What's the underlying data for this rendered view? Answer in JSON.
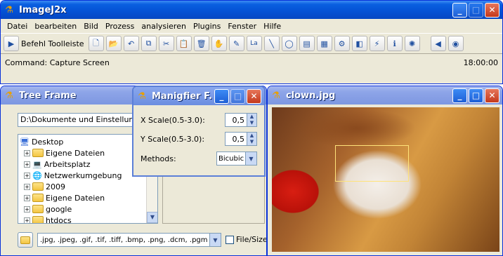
{
  "main_window": {
    "title": "ImageJ2x",
    "menus": [
      "Datei",
      "bearbeiten",
      "Bild",
      "Prozess",
      "analysieren",
      "Plugins",
      "Fenster",
      "Hilfe"
    ],
    "toolbar_label": "Befehl Toolleiste",
    "status_command": "Command: Capture Screen",
    "status_time": "18:00:00"
  },
  "tree_frame": {
    "title": "Tree Frame",
    "path": "D:\\Dokumente und Einstellungen\\",
    "items": [
      {
        "label": "Desktop",
        "icon": "desktop-icon"
      },
      {
        "label": "Eigene Dateien",
        "icon": "folder-icon"
      },
      {
        "label": "Arbeitsplatz",
        "icon": "computer-icon"
      },
      {
        "label": "Netzwerkumgebung",
        "icon": "network-icon"
      },
      {
        "label": "2009",
        "icon": "folder-icon"
      },
      {
        "label": "Eigene Dateien",
        "icon": "folder-icon"
      },
      {
        "label": "google",
        "icon": "folder-icon"
      },
      {
        "label": "htdocs",
        "icon": "folder-icon"
      }
    ],
    "filter": ".jpg, .jpeg, .gif, .tif, .tiff, .bmp, .png, .dcm, .pgm",
    "filesize_label": "File/Size"
  },
  "magnifier": {
    "title": "Manigfier F...",
    "x_label": "X Scale(0.5-3.0):",
    "x_value": "0,5",
    "y_label": "Y Scale(0.5-3.0):",
    "y_value": "0,5",
    "method_label": "Methods:",
    "method_value": "Bicubic"
  },
  "image_window": {
    "title": "clown.jpg"
  }
}
